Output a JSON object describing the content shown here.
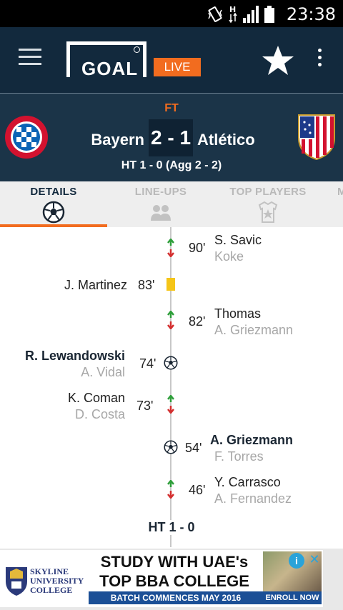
{
  "status_bar": {
    "time": "23:38"
  },
  "app_bar": {
    "logo_text": "GOAL",
    "live_label": "LIVE"
  },
  "match": {
    "status": "FT",
    "home_team": "Bayern",
    "away_team": "Atlético",
    "score": "2 - 1",
    "halftime_agg": "HT 1 - 0  (Agg 2 - 2)"
  },
  "tabs": [
    {
      "label": "DETAILS",
      "active": true
    },
    {
      "label": "LINE-UPS",
      "active": false
    },
    {
      "label": "TOP PLAYERS",
      "active": false
    },
    {
      "label": "M",
      "active": false
    }
  ],
  "events": [
    {
      "minute": "90'",
      "type": "substitution",
      "side": "away",
      "player_in": "S. Savic",
      "player_out": "Koke"
    },
    {
      "minute": "83'",
      "type": "yellow-card",
      "side": "home",
      "player": "J. Martinez"
    },
    {
      "minute": "82'",
      "type": "substitution",
      "side": "away",
      "player_in": "Thomas",
      "player_out": "A. Griezmann"
    },
    {
      "minute": "74'",
      "type": "goal",
      "side": "home",
      "scorer": "R. Lewandowski",
      "assist": "A. Vidal"
    },
    {
      "minute": "73'",
      "type": "substitution",
      "side": "home",
      "player_in": "K. Coman",
      "player_out": "D. Costa"
    },
    {
      "minute": "54'",
      "type": "goal",
      "side": "away",
      "scorer": "A. Griezmann",
      "assist": "F. Torres"
    },
    {
      "minute": "46'",
      "type": "substitution",
      "side": "away",
      "player_in": "Y. Carrasco",
      "player_out": "A. Fernandez"
    }
  ],
  "halftime_marker": "HT 1 - 0",
  "ad": {
    "logo_text": "SKYLINE UNIVERSITY COLLEGE",
    "headline_1": "STUDY WITH UAE's",
    "headline_2": "TOP BBA COLLEGE",
    "banner": "BATCH COMMENCES MAY 2016",
    "cta": "ENROLL NOW",
    "info": "i",
    "close": "✕"
  },
  "colors": {
    "accent": "#f26c1f",
    "header_bg": "#12293d",
    "scoreboard_bg": "#1b3448",
    "sub_in_arrow": "#2e9e3a",
    "sub_out_arrow": "#d32f2f",
    "yellow_card": "#f5c518"
  }
}
